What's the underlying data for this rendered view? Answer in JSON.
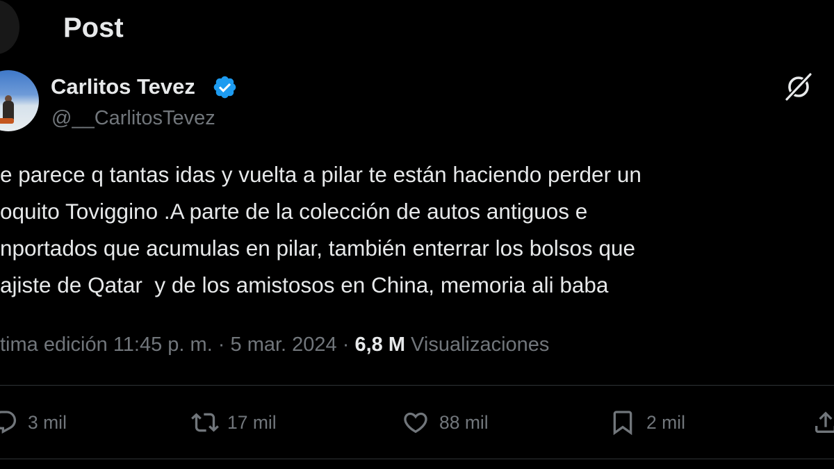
{
  "header": {
    "title": "Post"
  },
  "author": {
    "display_name": "Carlitos Tevez",
    "handle": "@__CarlitosTevez",
    "verified": true
  },
  "tweet": {
    "lines": [
      "e parece q tantas idas y vuelta a pilar te están haciendo perder un",
      "oquito Toviggino .A parte de la colección de autos antiguos e",
      "nportados que acumulas en pilar, también enterrar los bolsos que",
      "ajiste de Qatar  y de los amistosos en China, memoria ali baba"
    ]
  },
  "meta": {
    "edited_prefix": "tima edición ",
    "time": "11:45 p. m.",
    "separator": " · ",
    "date": "5 mar. 2024",
    "views_count": "6,8 M",
    "views_label": " Visualizaciones"
  },
  "actions": {
    "replies": "3 mil",
    "reposts": "17 mil",
    "likes": "88 mil",
    "bookmarks": "2 mil"
  },
  "colors": {
    "background": "#000000",
    "text_primary": "#e7e9ea",
    "text_secondary": "#71767b",
    "verified_badge": "#1d9bf0",
    "divider": "#2f3336"
  },
  "icons": {
    "back": "arrow-left-icon",
    "verified": "verified-badge-icon",
    "grok": "grok-icon",
    "reply": "reply-icon",
    "repost": "repost-icon",
    "like": "heart-icon",
    "bookmark": "bookmark-icon",
    "share": "share-icon"
  }
}
